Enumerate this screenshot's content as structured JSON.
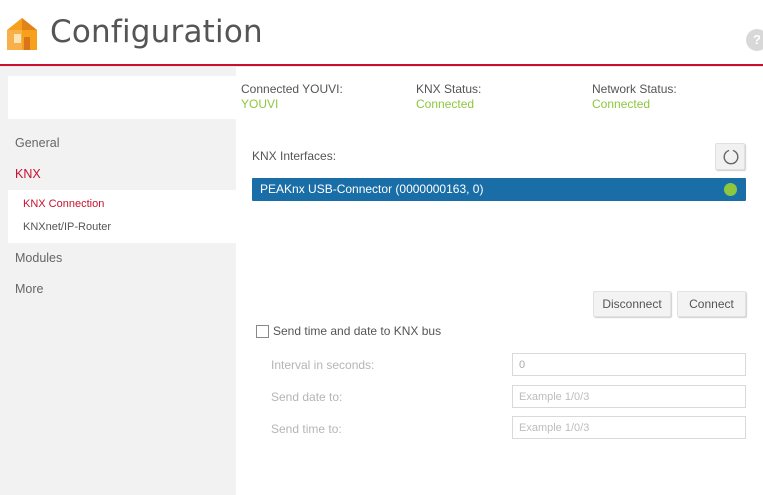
{
  "header": {
    "title": "Configuration",
    "help_glyph": "?",
    "accent_color": "#c8102e"
  },
  "status": {
    "youvi": {
      "label": "Connected YOUVI:",
      "value": "YOUVI"
    },
    "knx": {
      "label": "KNX Status:",
      "value": "Connected"
    },
    "network": {
      "label": "Network Status:",
      "value": "Connected"
    },
    "ok_color": "#8dc63f"
  },
  "sidebar": {
    "items": [
      {
        "label": "General"
      },
      {
        "label": "KNX",
        "active": true,
        "children": [
          {
            "label": "KNX Connection",
            "active": true
          },
          {
            "label": "KNXnet/IP-Router"
          }
        ]
      },
      {
        "label": "Modules"
      },
      {
        "label": "More"
      }
    ]
  },
  "interfaces": {
    "label": "KNX Interfaces:",
    "refresh_icon": "refresh-icon",
    "items": [
      {
        "name": "PEAKnx USB-Connector (0000000163, 0)",
        "selected": true,
        "status": "connected"
      }
    ],
    "selected_color": "#1a6ea8"
  },
  "actions": {
    "disconnect_label": "Disconnect",
    "connect_label": "Connect"
  },
  "time_sync": {
    "checkbox_label": "Send time and date to KNX bus",
    "checked": false,
    "interval": {
      "label": "Interval in seconds:",
      "value": "0"
    },
    "date_target": {
      "label": "Send date to:",
      "placeholder": "Example 1/0/3"
    },
    "time_target": {
      "label": "Send time to:",
      "placeholder": "Example 1/0/3"
    }
  }
}
